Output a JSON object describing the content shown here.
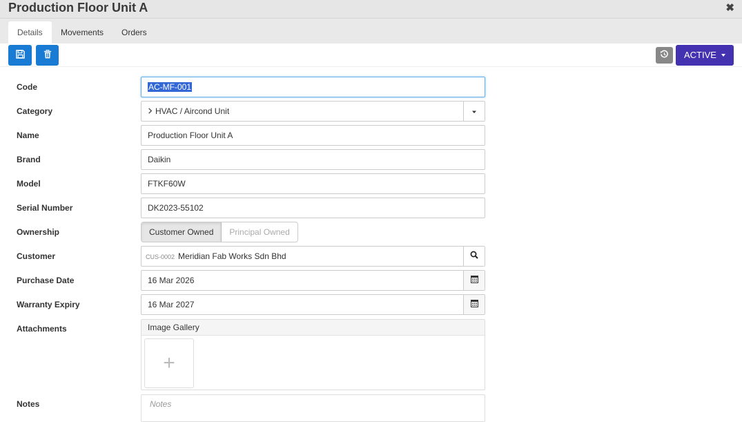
{
  "window": {
    "title": "Production Floor Unit A",
    "close_label": "✖"
  },
  "tabs": [
    {
      "label": "Details",
      "active": true
    },
    {
      "label": "Movements",
      "active": false
    },
    {
      "label": "Orders",
      "active": false
    }
  ],
  "toolbar": {
    "save_icon": "floppy-disk-icon",
    "delete_icon": "trash-icon",
    "history_icon": "history-icon",
    "status_label": "ACTIVE",
    "status_color": "#4433b0",
    "button_color": "#1a7bd4"
  },
  "form": {
    "code": {
      "label": "Code",
      "value": "AC-MF-001"
    },
    "category": {
      "label": "Category",
      "value": "HVAC / Aircond Unit"
    },
    "name": {
      "label": "Name",
      "value": "Production Floor Unit A"
    },
    "brand": {
      "label": "Brand",
      "value": "Daikin"
    },
    "model": {
      "label": "Model",
      "value": "FTKF60W"
    },
    "serial": {
      "label": "Serial Number",
      "value": "DK2023-55102"
    },
    "ownership": {
      "label": "Ownership",
      "options": [
        "Customer Owned",
        "Principal Owned"
      ],
      "selected": "Customer Owned"
    },
    "customer": {
      "label": "Customer",
      "code": "CUS-0002",
      "value": "Meridian Fab Works Sdn Bhd"
    },
    "purchase_date": {
      "label": "Purchase Date",
      "value": "16 Mar 2026"
    },
    "warranty_expiry": {
      "label": "Warranty Expiry",
      "value": "16 Mar 2027"
    },
    "attachments": {
      "label": "Attachments",
      "gallery_title": "Image Gallery",
      "add_glyph": "+"
    },
    "notes": {
      "label": "Notes",
      "placeholder": "Notes"
    }
  }
}
